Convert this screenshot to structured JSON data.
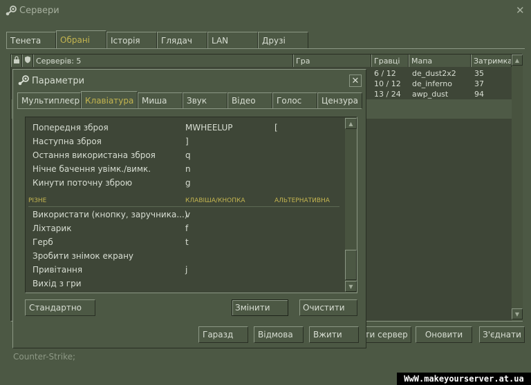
{
  "main_window": {
    "title": "Сервери",
    "close_glyph": "✕",
    "tabs": [
      {
        "label": "Тенета",
        "active": false
      },
      {
        "label": "Обрані",
        "active": true
      },
      {
        "label": "Історія",
        "active": false
      },
      {
        "label": "Глядач",
        "active": false
      },
      {
        "label": "LAN",
        "active": false
      },
      {
        "label": "Друзі",
        "active": false
      }
    ],
    "columns": {
      "servers": "Серверів: 5",
      "game": "Гра",
      "players": "Гравці",
      "map": "Мапа",
      "latency": "Затримка"
    },
    "rows": [
      {
        "players": "6 / 12",
        "map": "de_dust2x2",
        "latency": "35"
      },
      {
        "players": "10 / 12",
        "map": "de_inferno",
        "latency": "37"
      },
      {
        "players": "13 / 24",
        "map": "awp_dust",
        "latency": "94"
      }
    ],
    "bottom_buttons": {
      "add_server": "ати сервер",
      "refresh": "Оновити",
      "connect": "З'єднати"
    },
    "status": "Counter-Strike;",
    "watermark": "WwW.makeyourserver.at.ua"
  },
  "dialog": {
    "title": "Параметри",
    "close_glyph": "✕",
    "tabs": [
      {
        "label": "Мультиплеєр",
        "active": false
      },
      {
        "label": "Клавіатура",
        "active": true
      },
      {
        "label": "Миша",
        "active": false
      },
      {
        "label": "Звук",
        "active": false
      },
      {
        "label": "Відео",
        "active": false
      },
      {
        "label": "Голос",
        "active": false
      },
      {
        "label": "Цензура",
        "active": false
      }
    ],
    "bindings_top": [
      {
        "action": "Попередня зброя",
        "key": "MWHEELUP",
        "alt": "["
      },
      {
        "action": "Наступна зброя",
        "key": "]",
        "alt": ""
      },
      {
        "action": "Остання використана зброя",
        "key": "q",
        "alt": ""
      },
      {
        "action": "Нічне бачення увімк./вимк.",
        "key": "n",
        "alt": ""
      },
      {
        "action": "Кинути поточну зброю",
        "key": "g",
        "alt": ""
      }
    ],
    "section": {
      "name": "РІЗНЕ",
      "key_header": "КЛАВІША/КНОПКА",
      "alt_header": "АЛЬТЕРНАТИВНА"
    },
    "bindings_misc": [
      {
        "action": "Використати (кнопку, заручника...)",
        "key": "v",
        "alt": ""
      },
      {
        "action": "Ліхтарик",
        "key": "f",
        "alt": ""
      },
      {
        "action": "Герб",
        "key": "t",
        "alt": ""
      },
      {
        "action": "Зробити знімок екрану",
        "key": "",
        "alt": ""
      },
      {
        "action": "Привітання",
        "key": "j",
        "alt": ""
      },
      {
        "action": "Вихід з гри",
        "key": "",
        "alt": ""
      }
    ],
    "buttons": {
      "default": "Стандартно",
      "change": "Змінити",
      "clear": "Очистити",
      "ok": "Гаразд",
      "cancel": "Відмова",
      "apply": "Вжити"
    }
  }
}
